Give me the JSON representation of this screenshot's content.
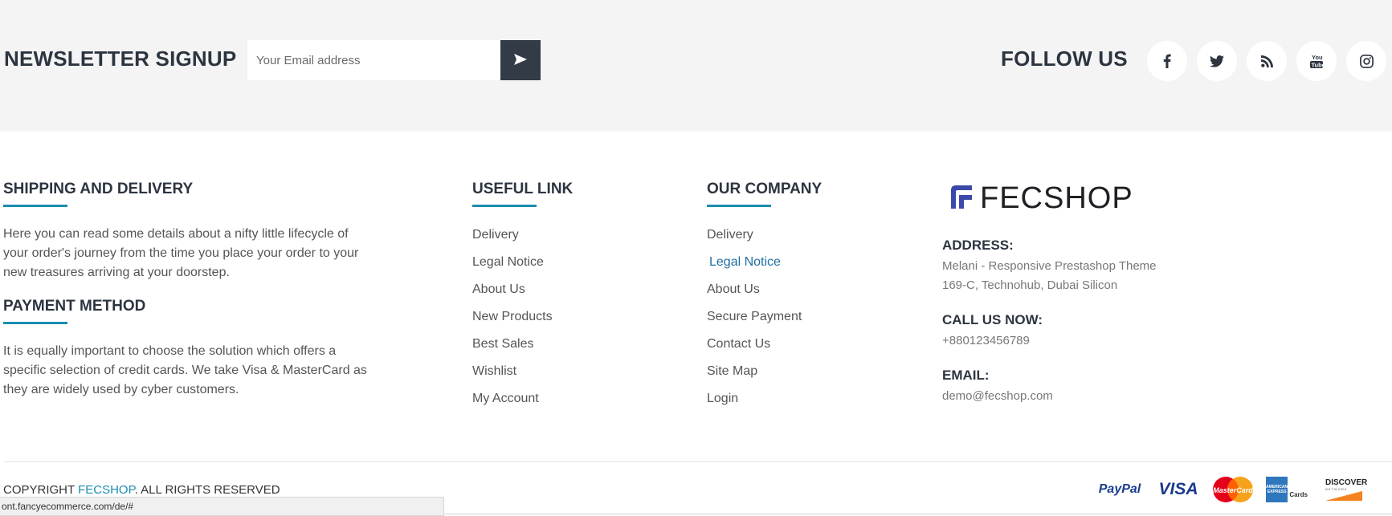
{
  "newsletter": {
    "title": "NEWSLETTER SIGNUP",
    "email_placeholder": "Your Email address"
  },
  "follow": {
    "title": "FOLLOW US",
    "icons": [
      "facebook-icon",
      "twitter-icon",
      "rss-icon",
      "youtube-icon",
      "instagram-icon"
    ]
  },
  "shipping": {
    "title": "SHIPPING AND DELIVERY",
    "text": "Here you can read some details about a nifty little lifecycle of your order's journey from the time you place your order to your new treasures arriving at your doorstep."
  },
  "payment": {
    "title": "PAYMENT METHOD",
    "text": "It is equally important to choose the solution which offers a specific selection of credit cards. We take Visa & MasterCard as they are widely used by cyber customers."
  },
  "useful_link": {
    "title": "USEFUL LINK",
    "items": [
      "Delivery",
      "Legal Notice",
      "About Us",
      "New Products",
      "Best Sales",
      "Wishlist",
      "My Account"
    ]
  },
  "our_company": {
    "title": "OUR COMPANY",
    "items": [
      "Delivery",
      "Legal Notice",
      "About Us",
      "Secure Payment",
      "Contact Us",
      "Site Map",
      "Login"
    ]
  },
  "contact": {
    "logo_text": "FECSHOP",
    "address_label": "ADDRESS:",
    "address_line1": "Melani - Responsive Prestashop Theme",
    "address_line2": "169-C, Technohub, Dubai Silicon",
    "call_label": "CALL US NOW:",
    "phone": "+880123456789",
    "email_label": "EMAIL:",
    "email": "demo@fecshop.com"
  },
  "copyright": {
    "prefix": "COPYRIGHT ",
    "brand": "FECSHOP",
    "suffix": ". ALL RIGHTS RESERVED"
  },
  "payments": {
    "paypal": "PayPal",
    "visa": "VISA",
    "mastercard": "MasterCard",
    "amex": "AMERICAN EXPRESS",
    "amex_cards": "Cards",
    "discover": "DISCOVER",
    "discover_sub": "NETWORK"
  },
  "statusbar": {
    "url": "ont.fancyecommerce.com/de/#"
  },
  "colors": {
    "accent": "#1c8db0",
    "dark": "#333b47",
    "band": "#f4f4f4"
  }
}
